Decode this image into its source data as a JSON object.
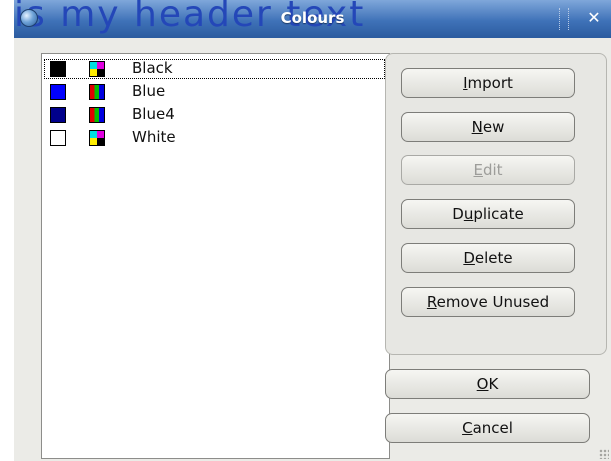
{
  "window": {
    "title": "Colours",
    "watermark_text": "is my header text"
  },
  "colours": [
    {
      "name": "Black",
      "swatch": "#000000",
      "model": "cmyk"
    },
    {
      "name": "Blue",
      "swatch": "#0000ff",
      "model": "rgb"
    },
    {
      "name": "Blue4",
      "swatch": "#00008b",
      "model": "rgb"
    },
    {
      "name": "White",
      "swatch": "#ffffff",
      "model": "cmyk"
    }
  ],
  "buttons": {
    "import": {
      "pre": "",
      "acc": "I",
      "post": "mport"
    },
    "new": {
      "pre": "",
      "acc": "N",
      "post": "ew"
    },
    "edit": {
      "pre": "",
      "acc": "E",
      "post": "dit"
    },
    "duplicate": {
      "pre": "D",
      "acc": "u",
      "post": "plicate"
    },
    "delete": {
      "pre": "",
      "acc": "D",
      "post": "elete"
    },
    "remove_unused": {
      "pre": "",
      "acc": "R",
      "post": "emove Unused"
    },
    "ok": {
      "pre": "",
      "acc": "O",
      "post": "K"
    },
    "cancel": {
      "pre": "",
      "acc": "C",
      "post": "ancel"
    }
  },
  "icons": {
    "app": "app-globe-icon",
    "close": "close-icon",
    "cmyk": "cmyk-spot-icon",
    "rgb": "rgb-spot-icon"
  },
  "colors": {
    "titlebar": "#3f72b8",
    "dialog_bg": "#ebebe7",
    "disabled_text": "#9d9d9a"
  }
}
